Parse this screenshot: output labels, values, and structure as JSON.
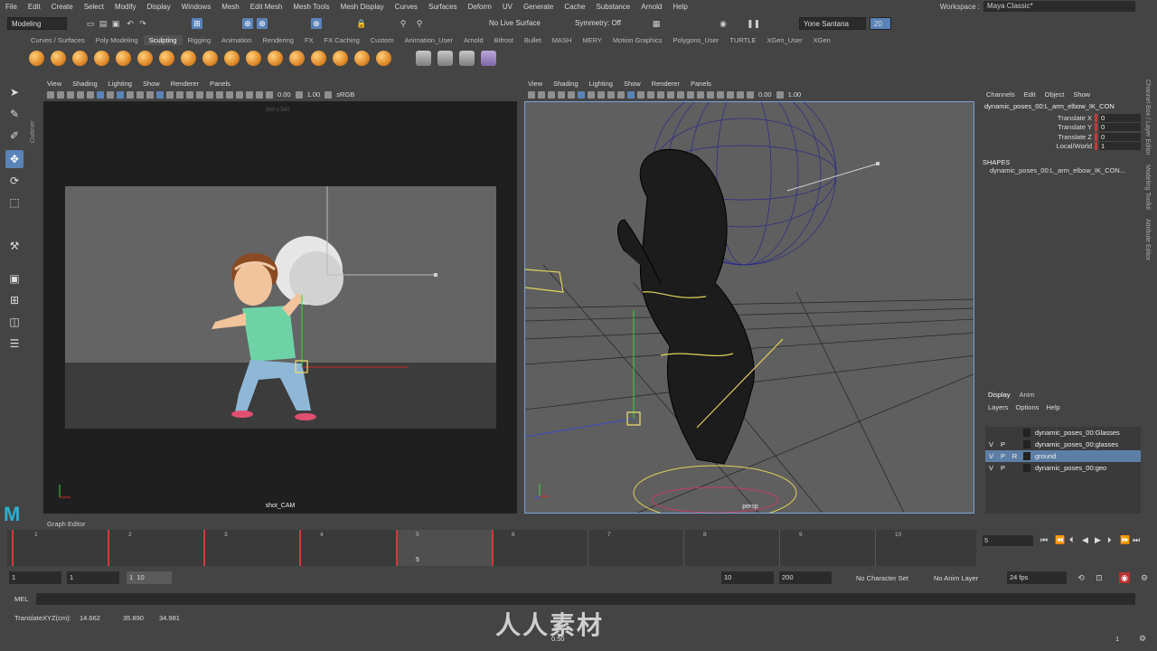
{
  "menubar": {
    "items": [
      "File",
      "Edit",
      "Create",
      "Select",
      "Modify",
      "Display",
      "Windows",
      "Mesh",
      "Edit Mesh",
      "Mesh Tools",
      "Mesh Display",
      "Curves",
      "Surfaces",
      "Deform",
      "UV",
      "Generate",
      "Cache",
      "Substance",
      "Arnold",
      "Help"
    ],
    "workspace_label": "Workspace :",
    "workspace_value": "Maya Classic*"
  },
  "statusline": {
    "mode": "Modeling",
    "live_surface": "No Live Surface",
    "symmetry": "Symmetry: Off",
    "user": "Yone Santana",
    "badge": "20"
  },
  "shelf": {
    "tabs": [
      "Curves / Surfaces",
      "Poly Modeling",
      "Sculpting",
      "Rigging",
      "Animation",
      "Rendering",
      "FX",
      "FX Caching",
      "Custom",
      "Animation_User",
      "Arnold",
      "Bifrost",
      "Bullet",
      "MASH",
      "MERY",
      "Motion Graphics",
      "Polygons_User",
      "TURTLE",
      "XGen_User",
      "XGen"
    ],
    "active": "Sculpting"
  },
  "outliner_label": "Outliner",
  "viewport_left": {
    "menus": [
      "View",
      "Shading",
      "Lighting",
      "Show",
      "Renderer",
      "Panels"
    ],
    "val1": "0.00",
    "val2": "1.00",
    "space": "sRGB",
    "resolution": "960 x 540",
    "camera": "shot_CAM"
  },
  "viewport_right": {
    "menus": [
      "View",
      "Shading",
      "Lighting",
      "Show",
      "Renderer",
      "Panels"
    ],
    "val1": "0.00",
    "val2": "1.00",
    "camera": "persp"
  },
  "channel_box": {
    "menus": [
      "Channels",
      "Edit",
      "Object",
      "Show"
    ],
    "node": "dynamic_poses_00:L_arm_elbow_IK_CON",
    "attrs": [
      {
        "label": "Translate X",
        "value": "0"
      },
      {
        "label": "Translate Y",
        "value": "0"
      },
      {
        "label": "Translate Z",
        "value": "0"
      },
      {
        "label": "Local/World",
        "value": "1"
      }
    ],
    "shapes_title": "SHAPES",
    "shape": "dynamic_poses_00:L_arm_elbow_IK_CON..."
  },
  "side_tabs": [
    "Channel Box / Layer Editor",
    "Modeling Toolkit",
    "Attribute Editor"
  ],
  "layer_editor": {
    "tabs": [
      "Display",
      "Anim"
    ],
    "menus": [
      "Layers",
      "Options",
      "Help"
    ],
    "layers": [
      {
        "v": "",
        "p": "",
        "name": "dynamic_poses_00:Glasses"
      },
      {
        "v": "V",
        "p": "P",
        "name": "dynamic_poses_00:glasses"
      },
      {
        "v": "V",
        "p": "P",
        "name": "ground"
      },
      {
        "v": "V",
        "p": "P",
        "name": "dynamic_poses_00:geo"
      }
    ]
  },
  "graph_editor_label": "Graph Editor",
  "timeslider": {
    "labels": [
      "1",
      "2",
      "3",
      "4",
      "5",
      "6",
      "7",
      "8",
      "9",
      "10"
    ],
    "current_frame": "5",
    "key_frames": [
      1,
      2,
      3,
      4,
      5,
      6
    ]
  },
  "playback": {
    "current": "5"
  },
  "range": {
    "start": "1",
    "start2": "1",
    "inner_a": "1",
    "inner_b": "10",
    "end": "10",
    "end2": "200",
    "character_set": "No Character Set",
    "anim_layer": "No Anim Layer",
    "fps": "24 fps"
  },
  "mel": {
    "label": "MEL"
  },
  "helpline": {
    "label": "TranslateXYZ(cm):",
    "x": "14.662",
    "y": "35.890",
    "z": "34.981"
  },
  "bottom": {
    "value": "0.50",
    "value2": "1"
  },
  "watermark": "人人素材",
  "colors": {
    "accent": "#5a83b8",
    "key": "#d23b3b",
    "bg": "#444444"
  }
}
